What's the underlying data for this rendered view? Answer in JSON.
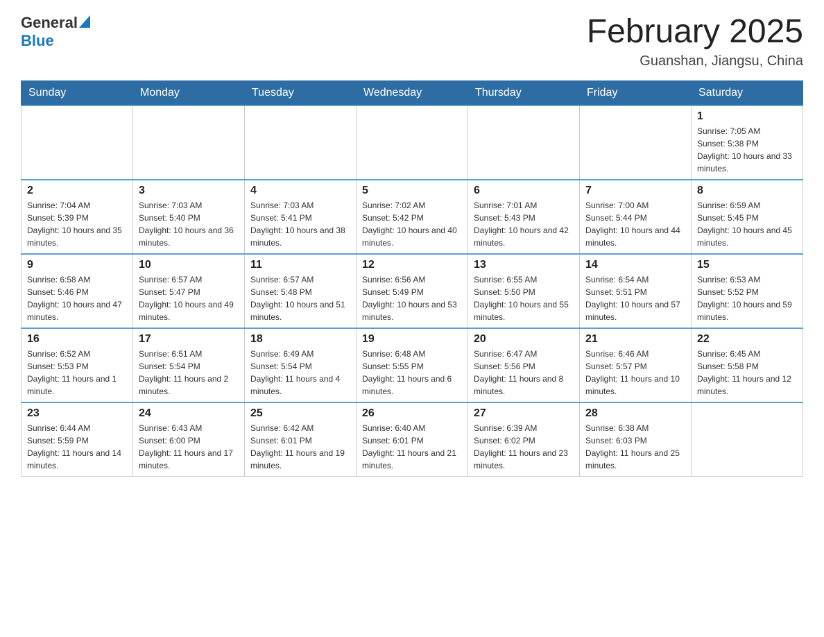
{
  "header": {
    "logo_general": "General",
    "logo_blue": "Blue",
    "month_title": "February 2025",
    "location": "Guanshan, Jiangsu, China"
  },
  "days_of_week": [
    "Sunday",
    "Monday",
    "Tuesday",
    "Wednesday",
    "Thursday",
    "Friday",
    "Saturday"
  ],
  "weeks": [
    [
      {
        "day": "",
        "sunrise": "",
        "sunset": "",
        "daylight": ""
      },
      {
        "day": "",
        "sunrise": "",
        "sunset": "",
        "daylight": ""
      },
      {
        "day": "",
        "sunrise": "",
        "sunset": "",
        "daylight": ""
      },
      {
        "day": "",
        "sunrise": "",
        "sunset": "",
        "daylight": ""
      },
      {
        "day": "",
        "sunrise": "",
        "sunset": "",
        "daylight": ""
      },
      {
        "day": "",
        "sunrise": "",
        "sunset": "",
        "daylight": ""
      },
      {
        "day": "1",
        "sunrise": "Sunrise: 7:05 AM",
        "sunset": "Sunset: 5:38 PM",
        "daylight": "Daylight: 10 hours and 33 minutes."
      }
    ],
    [
      {
        "day": "2",
        "sunrise": "Sunrise: 7:04 AM",
        "sunset": "Sunset: 5:39 PM",
        "daylight": "Daylight: 10 hours and 35 minutes."
      },
      {
        "day": "3",
        "sunrise": "Sunrise: 7:03 AM",
        "sunset": "Sunset: 5:40 PM",
        "daylight": "Daylight: 10 hours and 36 minutes."
      },
      {
        "day": "4",
        "sunrise": "Sunrise: 7:03 AM",
        "sunset": "Sunset: 5:41 PM",
        "daylight": "Daylight: 10 hours and 38 minutes."
      },
      {
        "day": "5",
        "sunrise": "Sunrise: 7:02 AM",
        "sunset": "Sunset: 5:42 PM",
        "daylight": "Daylight: 10 hours and 40 minutes."
      },
      {
        "day": "6",
        "sunrise": "Sunrise: 7:01 AM",
        "sunset": "Sunset: 5:43 PM",
        "daylight": "Daylight: 10 hours and 42 minutes."
      },
      {
        "day": "7",
        "sunrise": "Sunrise: 7:00 AM",
        "sunset": "Sunset: 5:44 PM",
        "daylight": "Daylight: 10 hours and 44 minutes."
      },
      {
        "day": "8",
        "sunrise": "Sunrise: 6:59 AM",
        "sunset": "Sunset: 5:45 PM",
        "daylight": "Daylight: 10 hours and 45 minutes."
      }
    ],
    [
      {
        "day": "9",
        "sunrise": "Sunrise: 6:58 AM",
        "sunset": "Sunset: 5:46 PM",
        "daylight": "Daylight: 10 hours and 47 minutes."
      },
      {
        "day": "10",
        "sunrise": "Sunrise: 6:57 AM",
        "sunset": "Sunset: 5:47 PM",
        "daylight": "Daylight: 10 hours and 49 minutes."
      },
      {
        "day": "11",
        "sunrise": "Sunrise: 6:57 AM",
        "sunset": "Sunset: 5:48 PM",
        "daylight": "Daylight: 10 hours and 51 minutes."
      },
      {
        "day": "12",
        "sunrise": "Sunrise: 6:56 AM",
        "sunset": "Sunset: 5:49 PM",
        "daylight": "Daylight: 10 hours and 53 minutes."
      },
      {
        "day": "13",
        "sunrise": "Sunrise: 6:55 AM",
        "sunset": "Sunset: 5:50 PM",
        "daylight": "Daylight: 10 hours and 55 minutes."
      },
      {
        "day": "14",
        "sunrise": "Sunrise: 6:54 AM",
        "sunset": "Sunset: 5:51 PM",
        "daylight": "Daylight: 10 hours and 57 minutes."
      },
      {
        "day": "15",
        "sunrise": "Sunrise: 6:53 AM",
        "sunset": "Sunset: 5:52 PM",
        "daylight": "Daylight: 10 hours and 59 minutes."
      }
    ],
    [
      {
        "day": "16",
        "sunrise": "Sunrise: 6:52 AM",
        "sunset": "Sunset: 5:53 PM",
        "daylight": "Daylight: 11 hours and 1 minute."
      },
      {
        "day": "17",
        "sunrise": "Sunrise: 6:51 AM",
        "sunset": "Sunset: 5:54 PM",
        "daylight": "Daylight: 11 hours and 2 minutes."
      },
      {
        "day": "18",
        "sunrise": "Sunrise: 6:49 AM",
        "sunset": "Sunset: 5:54 PM",
        "daylight": "Daylight: 11 hours and 4 minutes."
      },
      {
        "day": "19",
        "sunrise": "Sunrise: 6:48 AM",
        "sunset": "Sunset: 5:55 PM",
        "daylight": "Daylight: 11 hours and 6 minutes."
      },
      {
        "day": "20",
        "sunrise": "Sunrise: 6:47 AM",
        "sunset": "Sunset: 5:56 PM",
        "daylight": "Daylight: 11 hours and 8 minutes."
      },
      {
        "day": "21",
        "sunrise": "Sunrise: 6:46 AM",
        "sunset": "Sunset: 5:57 PM",
        "daylight": "Daylight: 11 hours and 10 minutes."
      },
      {
        "day": "22",
        "sunrise": "Sunrise: 6:45 AM",
        "sunset": "Sunset: 5:58 PM",
        "daylight": "Daylight: 11 hours and 12 minutes."
      }
    ],
    [
      {
        "day": "23",
        "sunrise": "Sunrise: 6:44 AM",
        "sunset": "Sunset: 5:59 PM",
        "daylight": "Daylight: 11 hours and 14 minutes."
      },
      {
        "day": "24",
        "sunrise": "Sunrise: 6:43 AM",
        "sunset": "Sunset: 6:00 PM",
        "daylight": "Daylight: 11 hours and 17 minutes."
      },
      {
        "day": "25",
        "sunrise": "Sunrise: 6:42 AM",
        "sunset": "Sunset: 6:01 PM",
        "daylight": "Daylight: 11 hours and 19 minutes."
      },
      {
        "day": "26",
        "sunrise": "Sunrise: 6:40 AM",
        "sunset": "Sunset: 6:01 PM",
        "daylight": "Daylight: 11 hours and 21 minutes."
      },
      {
        "day": "27",
        "sunrise": "Sunrise: 6:39 AM",
        "sunset": "Sunset: 6:02 PM",
        "daylight": "Daylight: 11 hours and 23 minutes."
      },
      {
        "day": "28",
        "sunrise": "Sunrise: 6:38 AM",
        "sunset": "Sunset: 6:03 PM",
        "daylight": "Daylight: 11 hours and 25 minutes."
      },
      {
        "day": "",
        "sunrise": "",
        "sunset": "",
        "daylight": ""
      }
    ]
  ]
}
